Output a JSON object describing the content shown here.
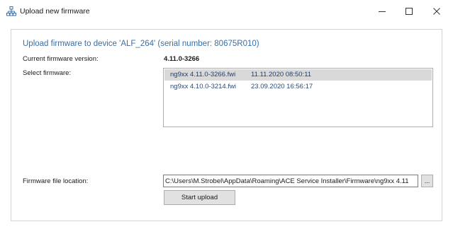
{
  "window": {
    "title": "Upload new firmware",
    "icon": "network-tree-icon",
    "controls": {
      "minimize": "minimize-icon",
      "maximize": "maximize-icon",
      "close": "close-icon"
    }
  },
  "main": {
    "heading": "Upload firmware to device 'ALF_264' (serial number: 80675R010)",
    "current_version_label": "Current firmware version:",
    "current_version_value": "4.11.0-3266",
    "select_label": "Select firmware:",
    "firmware_list": [
      {
        "file": "ng9xx 4.11.0-3266.fwi",
        "date": "11.11.2020 08:50:11",
        "selected": true
      },
      {
        "file": "ng9xx 4.10.0-3214.fwi",
        "date": "23.09.2020 16:56:17",
        "selected": false
      }
    ],
    "location_label": "Firmware file location:",
    "location_value": "C:\\Users\\M.Strobel\\AppData\\Roaming\\ACE Service Installer\\Firmware\\ng9xx 4.11",
    "browse_label": "...",
    "start_label": "Start upload"
  },
  "colors": {
    "accent": "#3a6ea5",
    "selection": "#d9d9d9",
    "button_face": "#e1e1e1"
  }
}
